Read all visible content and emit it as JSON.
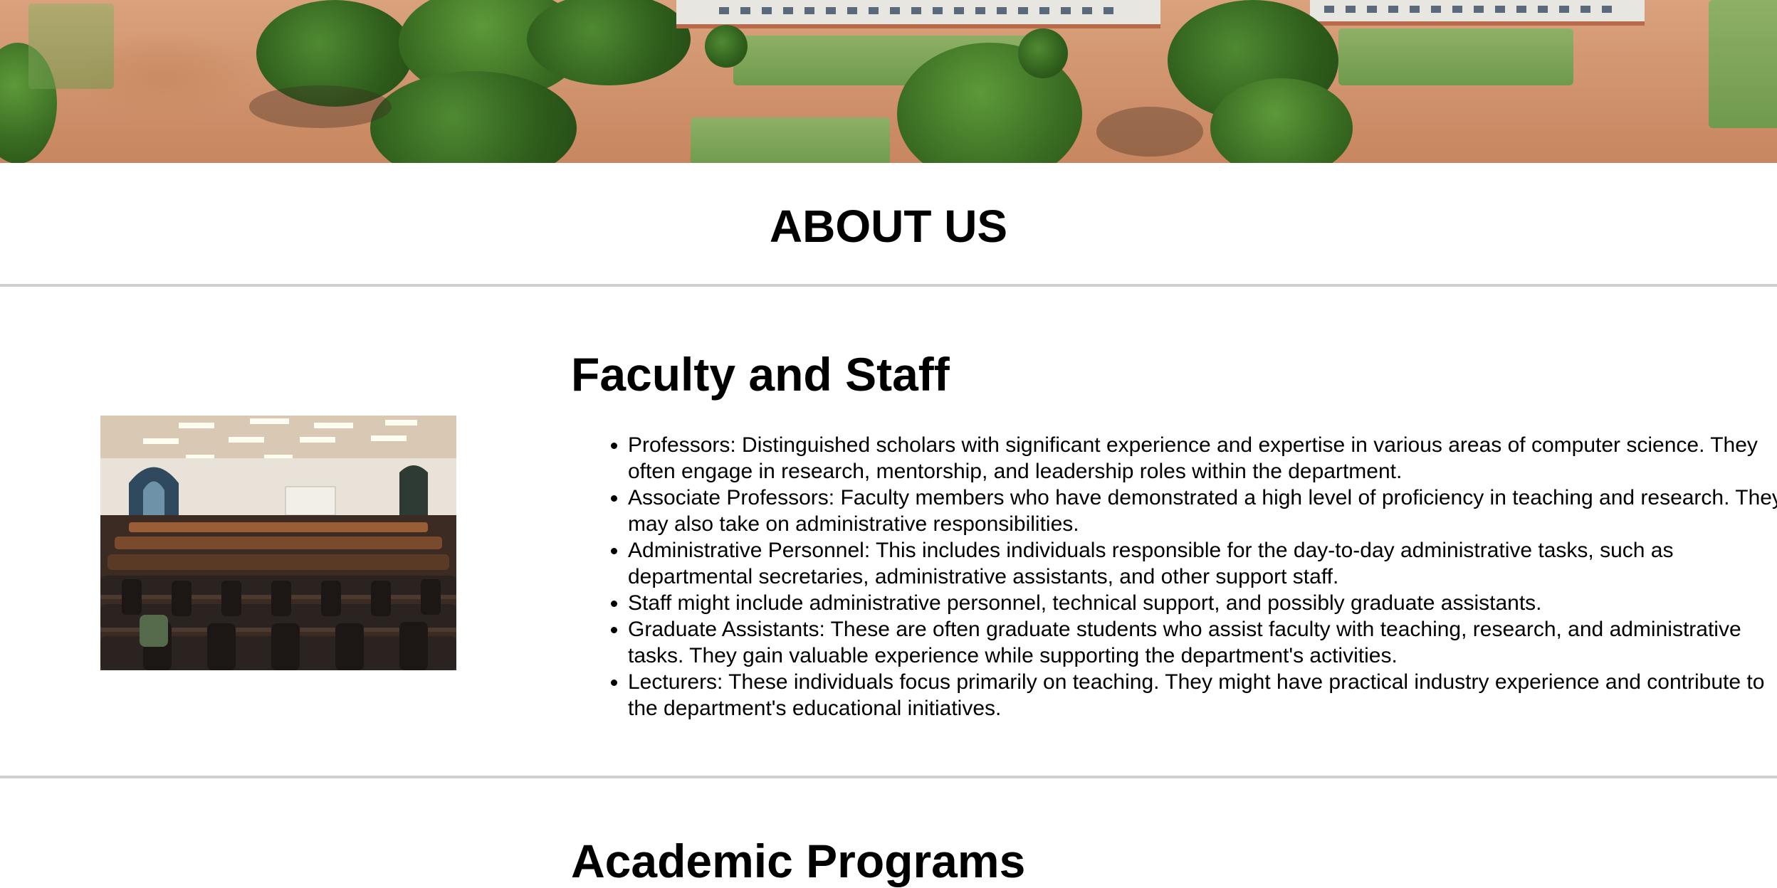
{
  "hero": {
    "image": "aerial campus photo"
  },
  "about": {
    "title": "ABOUT US"
  },
  "faculty": {
    "heading": "Faculty and Staff",
    "image": "lecture hall with rows of seats",
    "items": [
      "Professors: Distinguished scholars with significant experience and expertise in various areas of computer science. They often engage in research, mentorship, and leadership roles within the department.",
      "Associate Professors: Faculty members who have demonstrated a high level of proficiency in teaching and research. They may also take on administrative responsibilities.",
      "Administrative Personnel: This includes individuals responsible for the day-to-day administrative tasks, such as departmental secretaries, administrative assistants, and other support staff.",
      "Staff might include administrative personnel, technical support, and possibly graduate assistants.",
      "Graduate Assistants: These are often graduate students who assist faculty with teaching, research, and administrative tasks. They gain valuable experience while supporting the department's activities.",
      "Lecturers: These individuals focus primarily on teaching. They might have practical industry experience and contribute to the department's educational initiatives."
    ]
  },
  "next_section": {
    "heading": "Academic Programs"
  }
}
